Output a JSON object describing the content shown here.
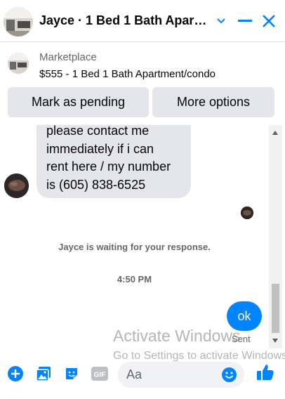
{
  "header": {
    "title": "Jayce · 1 Bed 1 Bath Apart...",
    "avatar_icon": "apartment-photo-avatar",
    "options_icon": "chevron-down-icon",
    "minimize_icon": "minimize-icon",
    "close_icon": "close-icon"
  },
  "listing": {
    "label": "Marketplace",
    "title": "$555 - 1 Bed 1 Bath Apartment/condo",
    "thumb_icon": "apartment-photo-thumbnail"
  },
  "actions": {
    "mark_pending": "Mark as pending",
    "more_options": "More options"
  },
  "messages": {
    "incoming_lines": [
      "please contact me",
      "immediately if i can",
      "rent here / my number",
      "is (605) 838-6525"
    ],
    "waiting_notice": "Jayce is waiting for your response.",
    "timestamp": "4:50 PM",
    "outgoing_text": "ok",
    "outgoing_status": "Sent"
  },
  "watermark": {
    "line1": "Activate Windows",
    "line2": "Go to Settings to activate Windows."
  },
  "composer": {
    "placeholder": "Aa",
    "icons": [
      "plus-circle-icon",
      "photo-icon",
      "sticker-icon",
      "gif-icon",
      "emoji-icon",
      "thumbs-up-icon"
    ]
  },
  "colors": {
    "accent": "#0084ff",
    "bubble_gray": "#e4e6eb",
    "muted_text": "#65676b"
  }
}
